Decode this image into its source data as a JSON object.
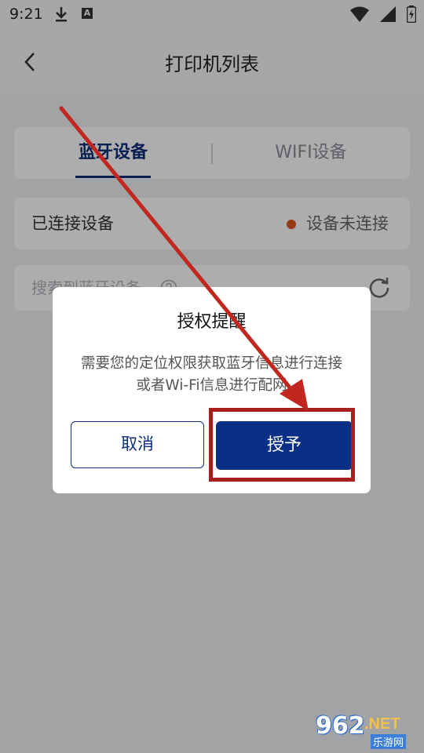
{
  "status_bar": {
    "time": "9:21"
  },
  "app_bar": {
    "title": "打印机列表"
  },
  "tabs": {
    "bluetooth": "蓝牙设备",
    "wifi": "WIFI设备"
  },
  "connected_device": {
    "label": "已连接设备",
    "status": "设备未连接",
    "status_color": "#e0551f"
  },
  "search": {
    "text": "搜索到蓝牙设备"
  },
  "dialog": {
    "title": "授权提醒",
    "message": "需要您的定位权限获取蓝牙信息进行连接或者Wi-Fi信息进行配网",
    "cancel_label": "取消",
    "grant_label": "授予"
  },
  "watermark": {
    "number": "962",
    "domain": ".NET",
    "name": "乐游网"
  },
  "colors": {
    "primary": "#0a2f86",
    "annotation": "#a8201d"
  }
}
